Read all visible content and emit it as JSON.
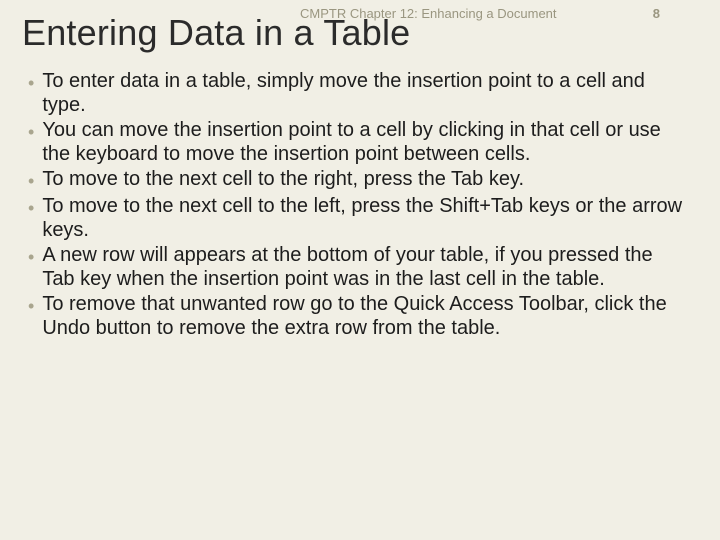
{
  "header": {
    "chapter": "CMPTR Chapter 12: Enhancing a Document",
    "page_number": "8"
  },
  "title": "Entering Data in a Table",
  "bullets": [
    "To enter data in a table, simply move the insertion point to a cell and type.",
    "You can move the insertion point to a cell by clicking in that cell or use the keyboard to move the insertion point between cells.",
    "To move to the next cell to the right, press the Tab key.",
    "To move to the next cell to the left, press the Shift+Tab keys or the arrow keys.",
    "A new row will appears at the bottom of your table, if you pressed the Tab key when the insertion point was in the last cell in the table.",
    "To remove that unwanted row go to the Quick Access Toolbar, click the Undo button  to remove the extra row from the table."
  ]
}
